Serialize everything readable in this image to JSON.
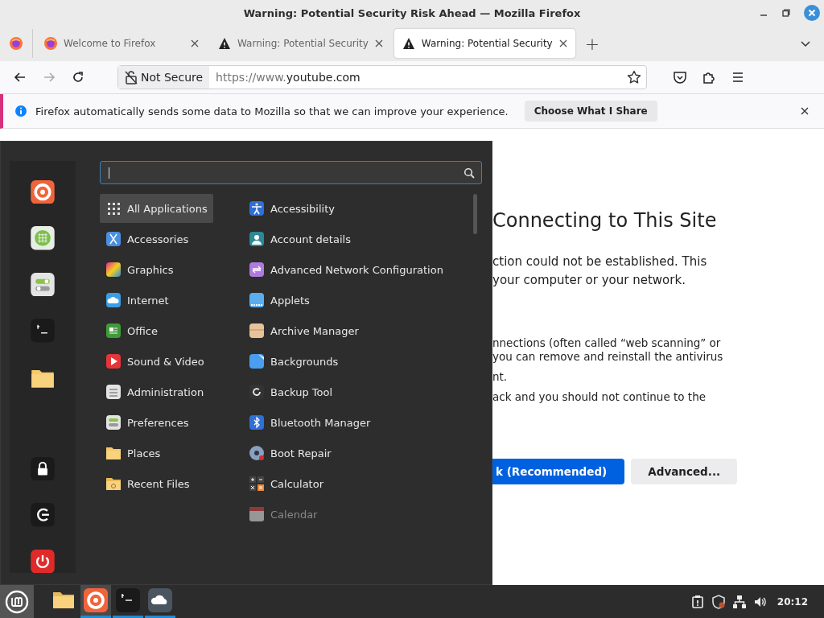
{
  "window": {
    "title": "Warning: Potential Security Risk Ahead — Mozilla Firefox"
  },
  "tabs": [
    {
      "label": "Welcome to Firefox",
      "kind": "firefox",
      "selected": false
    },
    {
      "label": "Warning: Potential Security",
      "kind": "warning",
      "selected": false
    },
    {
      "label": "Warning: Potential Security",
      "kind": "warning",
      "selected": true
    }
  ],
  "new_tab": "+",
  "address_bar": {
    "badge": "Not Secure",
    "url_prefix": "https://www.",
    "url_host": "youtube.com"
  },
  "notification": {
    "text": "Firefox automatically sends some data to Mozilla so that we can improve your experience.",
    "button": "Choose What I Share"
  },
  "page": {
    "heading": "Connecting to This Site",
    "paragraphs": [
      [
        "ction could not be established. This",
        "your computer or your network."
      ],
      [
        "nnections (often called “web scanning” or",
        "you can remove and reinstall the antivirus"
      ],
      [
        "nt."
      ],
      [
        "ack and you should not continue to the"
      ]
    ],
    "buttons": [
      {
        "label": "k (Recommended)",
        "kind": "primary"
      },
      {
        "label": "Advanced...",
        "kind": "secondary"
      }
    ]
  },
  "menu": {
    "categories": [
      {
        "label": "All Applications",
        "selected": true
      },
      {
        "label": "Accessories",
        "selected": false
      },
      {
        "label": "Graphics",
        "selected": false
      },
      {
        "label": "Internet",
        "selected": false
      },
      {
        "label": "Office",
        "selected": false
      },
      {
        "label": "Sound & Video",
        "selected": false
      },
      {
        "label": "Administration",
        "selected": false
      },
      {
        "label": "Preferences",
        "selected": false
      },
      {
        "label": "Places",
        "selected": false
      },
      {
        "label": "Recent Files",
        "selected": false
      }
    ],
    "apps": [
      {
        "label": "Accessibility",
        "dimmed": false
      },
      {
        "label": "Account details",
        "dimmed": false
      },
      {
        "label": "Advanced Network Configuration",
        "dimmed": false
      },
      {
        "label": "Applets",
        "dimmed": false
      },
      {
        "label": "Archive Manager",
        "dimmed": false
      },
      {
        "label": "Backgrounds",
        "dimmed": false
      },
      {
        "label": "Backup Tool",
        "dimmed": false
      },
      {
        "label": "Bluetooth Manager",
        "dimmed": false
      },
      {
        "label": "Boot Repair",
        "dimmed": false
      },
      {
        "label": "Calculator",
        "dimmed": false
      },
      {
        "label": "Calendar",
        "dimmed": true
      }
    ]
  },
  "taskbar": {
    "apps": [
      {
        "kind": "folder",
        "active": false,
        "running": false
      },
      {
        "kind": "firefox",
        "active": true,
        "running": true
      },
      {
        "kind": "terminal",
        "active": false,
        "running": true
      },
      {
        "kind": "cloud",
        "active": false,
        "running": true
      }
    ],
    "clock": "20:12"
  }
}
